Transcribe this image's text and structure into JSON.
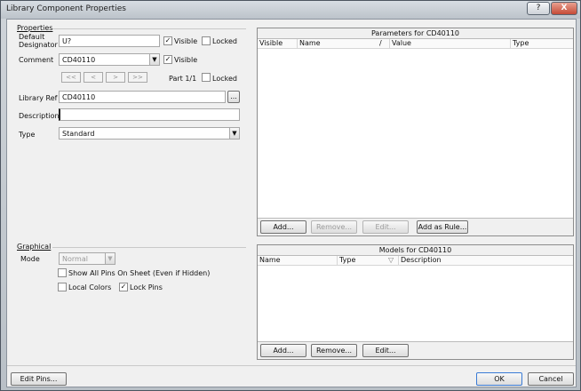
{
  "window": {
    "title": "Library Component Properties",
    "help_label": "?",
    "close_label": "X"
  },
  "properties": {
    "section_label": "Properties",
    "default_designator_label": "Default\nDesignator",
    "default_designator_value": "U?",
    "visible_label": "Visible",
    "locked_label": "Locked",
    "comment_label": "Comment",
    "comment_value": "CD40110",
    "comment_visible_label": "Visible",
    "nav_first": "<<",
    "nav_prev": "<",
    "nav_next": ">",
    "nav_last": ">>",
    "part_label": "Part 1/1",
    "part_locked_label": "Locked",
    "library_ref_label": "Library Ref",
    "library_ref_value": "CD40110",
    "browse_label": "...",
    "description_label": "Description",
    "description_value": "",
    "type_label": "Type",
    "type_value": "Standard",
    "designator_visible": true,
    "designator_locked": false,
    "comment_visible": true,
    "part_locked": false
  },
  "graphical": {
    "section_label": "Graphical",
    "mode_label": "Mode",
    "mode_value": "Normal",
    "show_all_pins_label": "Show All Pins On Sheet (Even if Hidden)",
    "local_colors_label": "Local Colors",
    "lock_pins_label": "Lock Pins",
    "show_all_pins": false,
    "local_colors": false,
    "lock_pins": true
  },
  "parameters": {
    "header": "Parameters for CD40110",
    "columns": [
      "Visible",
      "Name",
      "/",
      "Value",
      "Type"
    ],
    "add_label": "Add...",
    "remove_label": "Remove...",
    "edit_label": "Edit...",
    "add_as_rule_label": "Add as Rule..."
  },
  "models": {
    "header": "Models for CD40110",
    "columns": [
      "Name",
      "Type",
      "▽",
      "Description"
    ],
    "add_label": "Add...",
    "remove_label": "Remove...",
    "edit_label": "Edit..."
  },
  "footer": {
    "edit_pins_label": "Edit Pins...",
    "ok_label": "OK",
    "cancel_label": "Cancel"
  }
}
